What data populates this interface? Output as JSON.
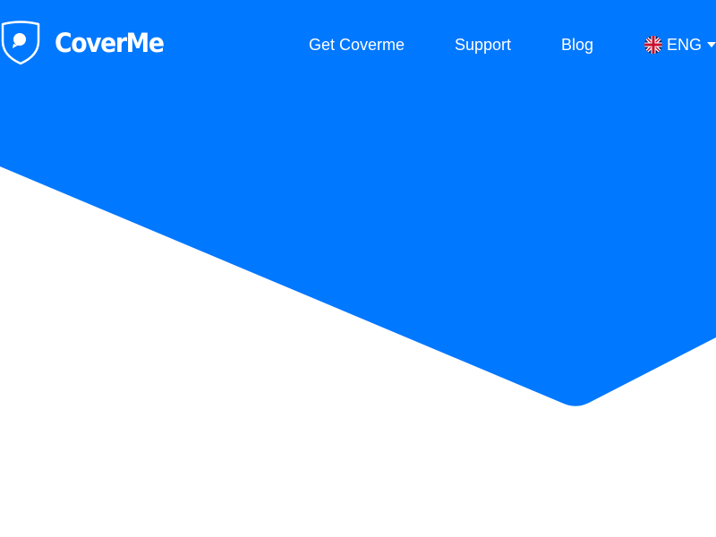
{
  "brand": {
    "name": "CoverMe",
    "color": "#0078ff"
  },
  "nav": {
    "items": [
      {
        "label": "Get Coverme"
      },
      {
        "label": "Support"
      },
      {
        "label": "Blog"
      }
    ]
  },
  "language": {
    "label": "ENG",
    "icon": "uk-flag-icon"
  },
  "icons": {
    "logo": "shield-chat-icon",
    "dropdown": "caret-down-icon"
  }
}
